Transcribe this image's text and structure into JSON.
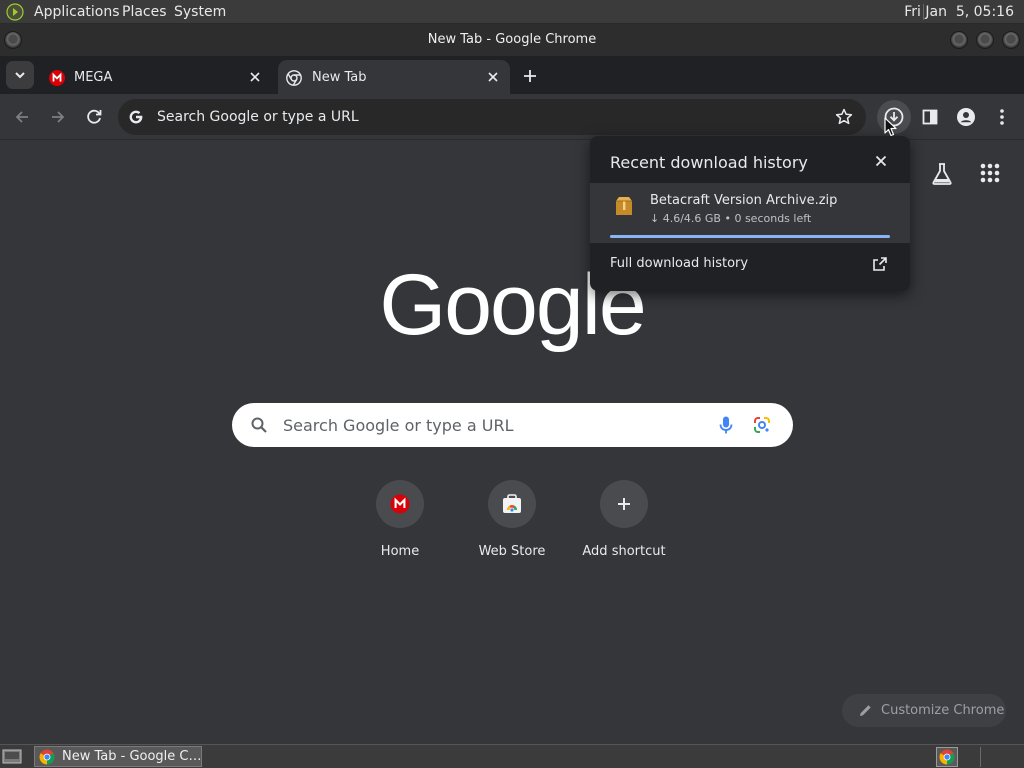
{
  "system_bar": {
    "menus": [
      "Applications",
      "Places",
      "System"
    ],
    "clock": "Fri Jan  5, 05:16"
  },
  "window": {
    "title": "New Tab - Google Chrome"
  },
  "tabs": [
    {
      "label": "MEGA",
      "icon": "mega-icon",
      "active": false
    },
    {
      "label": "New Tab",
      "icon": "chrome-icon",
      "active": true
    }
  ],
  "omnibox": {
    "placeholder": "Search Google or type a URL"
  },
  "page": {
    "search_placeholder": "Search Google or type a URL",
    "shortcuts": [
      {
        "label": "Home",
        "icon": "mega-icon"
      },
      {
        "label": "Web Store",
        "icon": "web-store-icon"
      },
      {
        "label": "Add shortcut",
        "icon": "plus-icon"
      }
    ],
    "customize_label": "Customize Chrome"
  },
  "download_popup": {
    "title": "Recent download history",
    "item": {
      "filename": "Betacraft Version Archive.zip",
      "status": "↓ 4.6/4.6 GB • 0 seconds left",
      "progress": 1.0
    },
    "full_history_label": "Full download history"
  },
  "taskbar": {
    "task_label": "New Tab - Google C…"
  },
  "colors": {
    "accent": "#8ab4f8",
    "mega_red": "#d90007",
    "page_bg": "#35363a"
  }
}
